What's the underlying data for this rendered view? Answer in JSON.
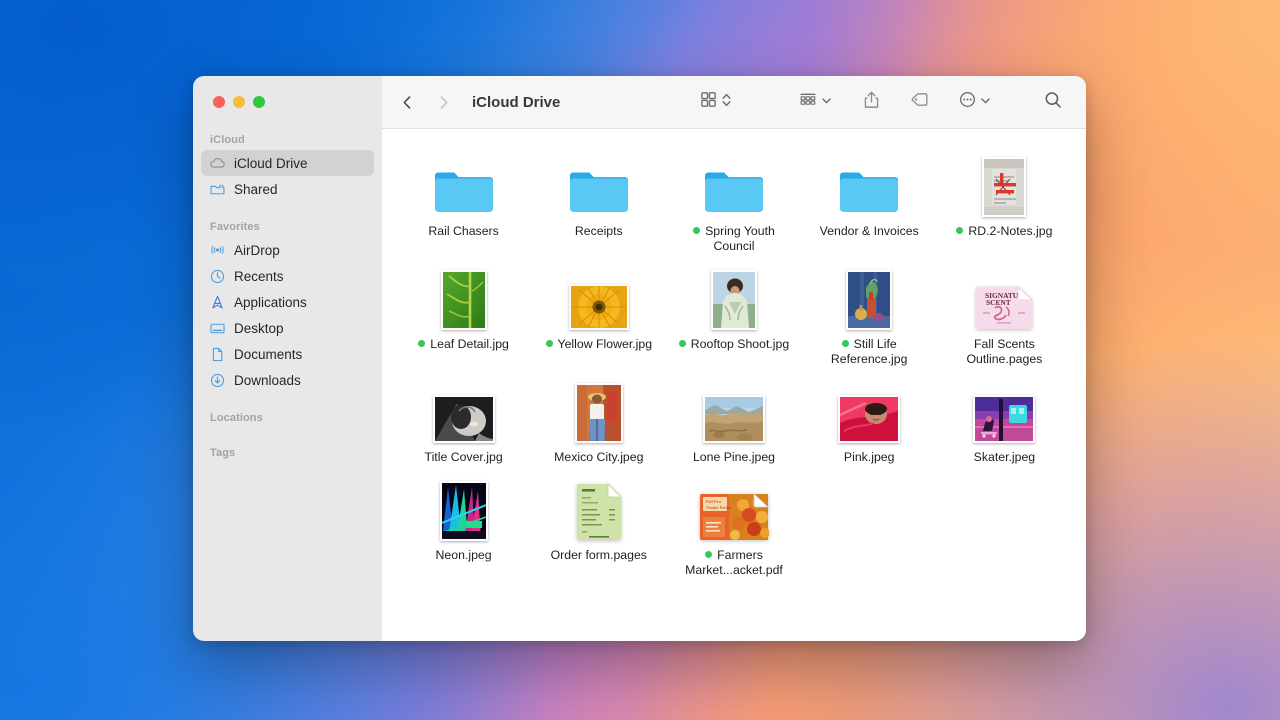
{
  "window": {
    "title": "iCloud Drive",
    "traffic_lights": [
      {
        "name": "close",
        "color": "#f5635b"
      },
      {
        "name": "minimize",
        "color": "#f6bc3e"
      },
      {
        "name": "maximize",
        "color": "#2fc93b"
      }
    ]
  },
  "toolbar": {
    "back_label": "Back",
    "forward_label": "Forward",
    "title": "iCloud Drive",
    "buttons": [
      {
        "icon": "grid-view-icon",
        "label": "View"
      },
      {
        "icon": "group-by-icon",
        "label": "Group"
      },
      {
        "icon": "share-icon",
        "label": "Share"
      },
      {
        "icon": "tag-icon",
        "label": "Tags"
      },
      {
        "icon": "more-icon",
        "label": "More"
      },
      {
        "icon": "search-icon",
        "label": "Search"
      }
    ]
  },
  "sidebar": {
    "sections": [
      {
        "title": "iCloud",
        "items": [
          {
            "label": "iCloud Drive",
            "icon": "cloud-icon",
            "selected": true
          },
          {
            "label": "Shared",
            "icon": "shared-folder-icon",
            "selected": false
          }
        ]
      },
      {
        "title": "Favorites",
        "items": [
          {
            "label": "AirDrop",
            "icon": "airdrop-icon",
            "selected": false
          },
          {
            "label": "Recents",
            "icon": "clock-icon",
            "selected": false
          },
          {
            "label": "Applications",
            "icon": "applications-icon",
            "selected": false
          },
          {
            "label": "Desktop",
            "icon": "desktop-icon",
            "selected": false
          },
          {
            "label": "Documents",
            "icon": "document-icon",
            "selected": false
          },
          {
            "label": "Downloads",
            "icon": "downloads-icon",
            "selected": false
          }
        ]
      },
      {
        "title": "Locations",
        "items": []
      },
      {
        "title": "Tags",
        "items": []
      }
    ]
  },
  "files": [
    {
      "name": "Rail Chasers",
      "kind": "folder",
      "badge": false
    },
    {
      "name": "Receipts",
      "kind": "folder",
      "badge": false
    },
    {
      "name": "Spring Youth Council",
      "kind": "folder",
      "badge": true
    },
    {
      "name": "Vendor & Invoices",
      "kind": "folder",
      "badge": false
    },
    {
      "name": "RD.2-Notes.jpg",
      "kind": "photo-notes",
      "badge": true
    },
    {
      "name": "Leaf Detail.jpg",
      "kind": "photo-leaf",
      "badge": true
    },
    {
      "name": "Yellow Flower.jpg",
      "kind": "photo-flower",
      "badge": true
    },
    {
      "name": "Rooftop Shoot.jpg",
      "kind": "photo-rooftop",
      "badge": true
    },
    {
      "name": "Still Life Reference.jpg",
      "kind": "photo-stilllife",
      "badge": true
    },
    {
      "name": "Fall Scents Outline.pages",
      "kind": "pages-pink",
      "badge": false
    },
    {
      "name": "Title Cover.jpg",
      "kind": "photo-titlecover",
      "badge": false
    },
    {
      "name": "Mexico City.jpeg",
      "kind": "photo-mexico",
      "badge": false
    },
    {
      "name": "Lone Pine.jpeg",
      "kind": "photo-lonepine",
      "badge": false
    },
    {
      "name": "Pink.jpeg",
      "kind": "photo-pink",
      "badge": false
    },
    {
      "name": "Skater.jpeg",
      "kind": "photo-skater",
      "badge": false
    },
    {
      "name": "Neon.jpeg",
      "kind": "photo-neon",
      "badge": false
    },
    {
      "name": "Order form.pages",
      "kind": "pages-green",
      "badge": false
    },
    {
      "name": "Farmers Market...acket.pdf",
      "kind": "pdf-farmers",
      "badge": true
    }
  ],
  "colors": {
    "folder_front": "#5ac8f5",
    "folder_tab": "#2aa9e8",
    "badge_green": "#34c759",
    "sidebar_bg": "#e9e8e9",
    "selected_row": "#d2d1d3"
  }
}
